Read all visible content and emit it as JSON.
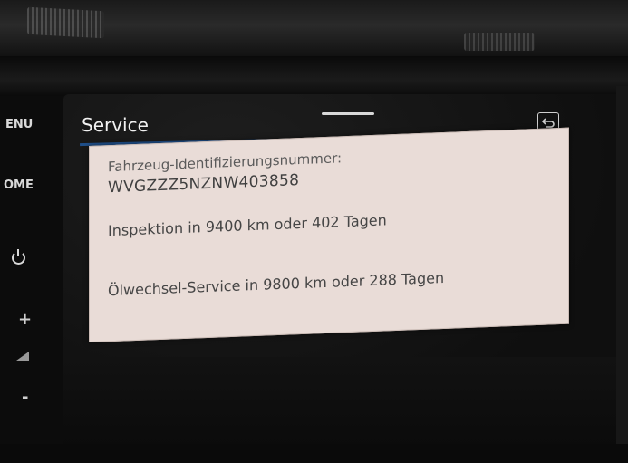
{
  "side_buttons": {
    "menu_label": "ENU",
    "home_label": "OME",
    "plus_label": "+",
    "minus_label": "-"
  },
  "header": {
    "title": "Service"
  },
  "service": {
    "vin_label": "Fahrzeug-Identifizierungsnummer:",
    "vin_value": "WVGZZZ5NZNW403858",
    "inspection": "Inspektion in 9400 km oder 402 Tagen",
    "oil_change": "Ölwechsel-Service in 9800 km oder 288 Tagen"
  },
  "icons": {
    "back": "back-arrow-icon",
    "power": "power-icon",
    "volume": "volume-icon"
  },
  "colors": {
    "panel_background": "#e9dcd7",
    "accent_line": "#1f4f8a",
    "screen_background": "#0f0f0f"
  }
}
